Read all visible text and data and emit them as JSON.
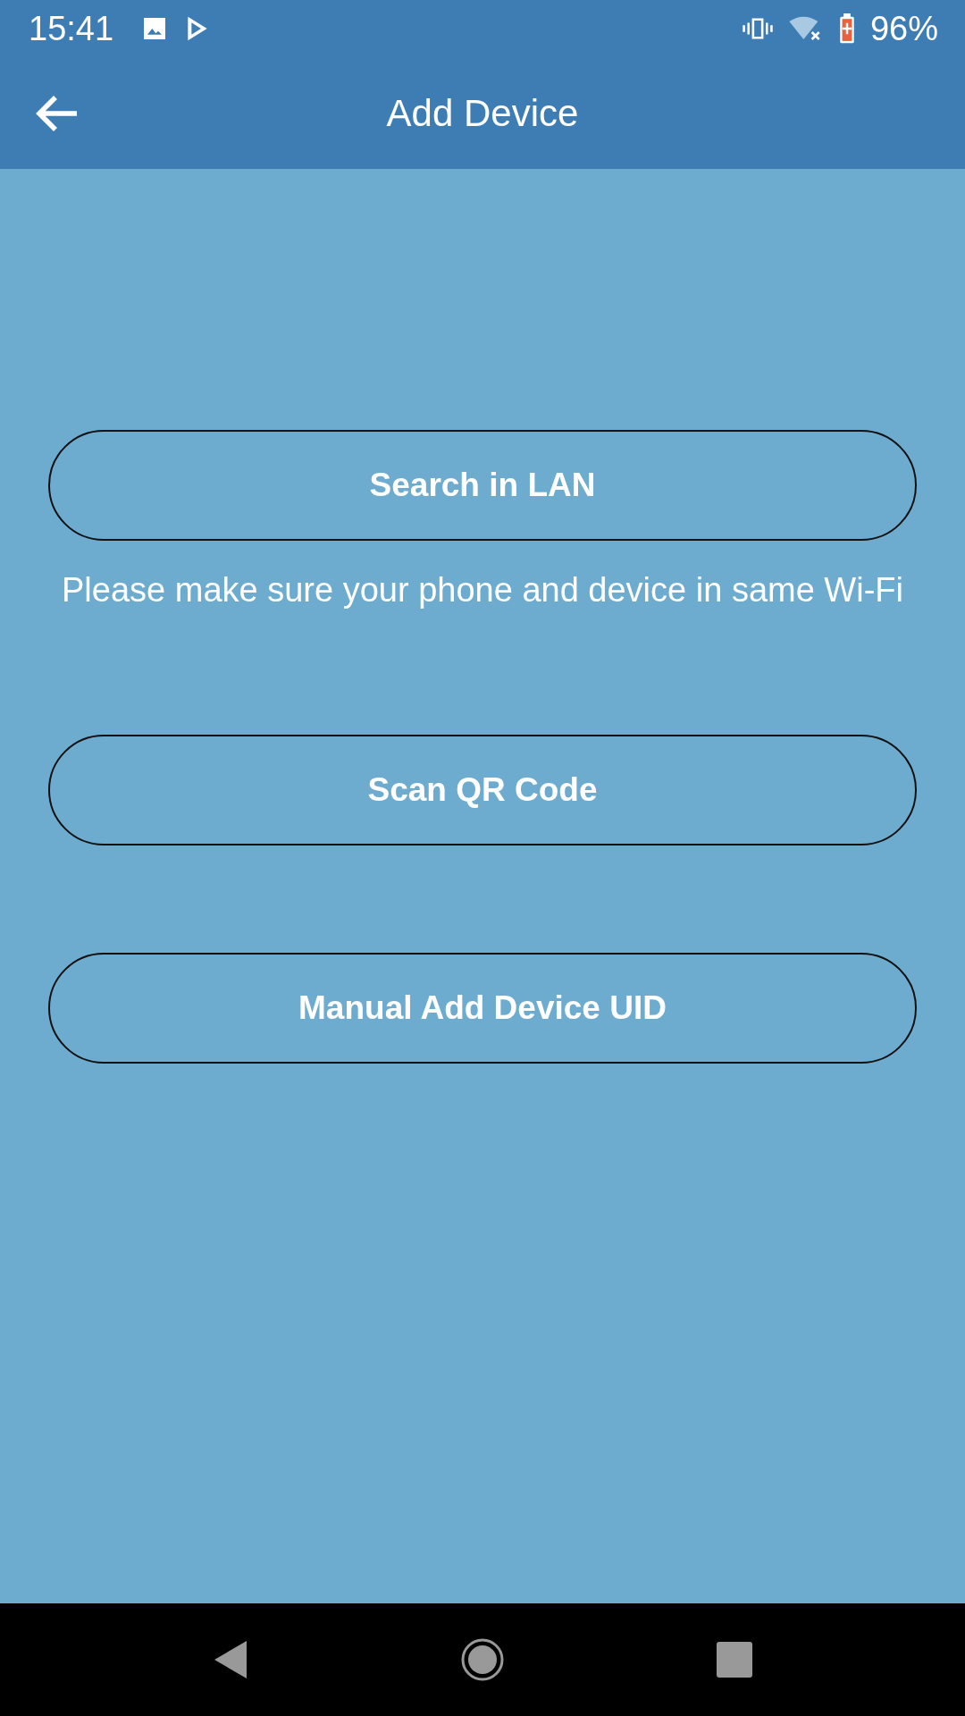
{
  "status_bar": {
    "time": "15:41",
    "battery": "96%"
  },
  "app_bar": {
    "title": "Add Device"
  },
  "options": [
    {
      "label": "Search in LAN",
      "hint": "Please make sure your phone and device in same Wi-Fi"
    },
    {
      "label": "Scan QR Code"
    },
    {
      "label": "Manual Add Device UID"
    }
  ]
}
